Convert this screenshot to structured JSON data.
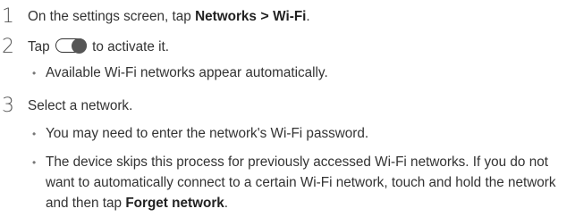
{
  "steps": [
    {
      "number": "1",
      "text_before": "On the settings screen, tap ",
      "bold_1": "Networks",
      "separator": " > ",
      "bold_2": "Wi-Fi",
      "text_after": "."
    },
    {
      "number": "2",
      "text_before": "Tap ",
      "toggle_icon": "toggle-switch-icon",
      "text_after": " to activate it.",
      "bullets": [
        "Available Wi-Fi networks appear automatically."
      ]
    },
    {
      "number": "3",
      "text": "Select a network.",
      "bullets": [
        "You may need to enter the network's Wi-Fi password.",
        "The device skips this process for previously accessed Wi-Fi networks. If you do not want to automatically connect to a certain Wi-Fi network, touch and hold the network and then tap "
      ],
      "bullet_2_bold": "Forget network",
      "bullet_2_end": "."
    }
  ],
  "bullet_glyph": "•"
}
